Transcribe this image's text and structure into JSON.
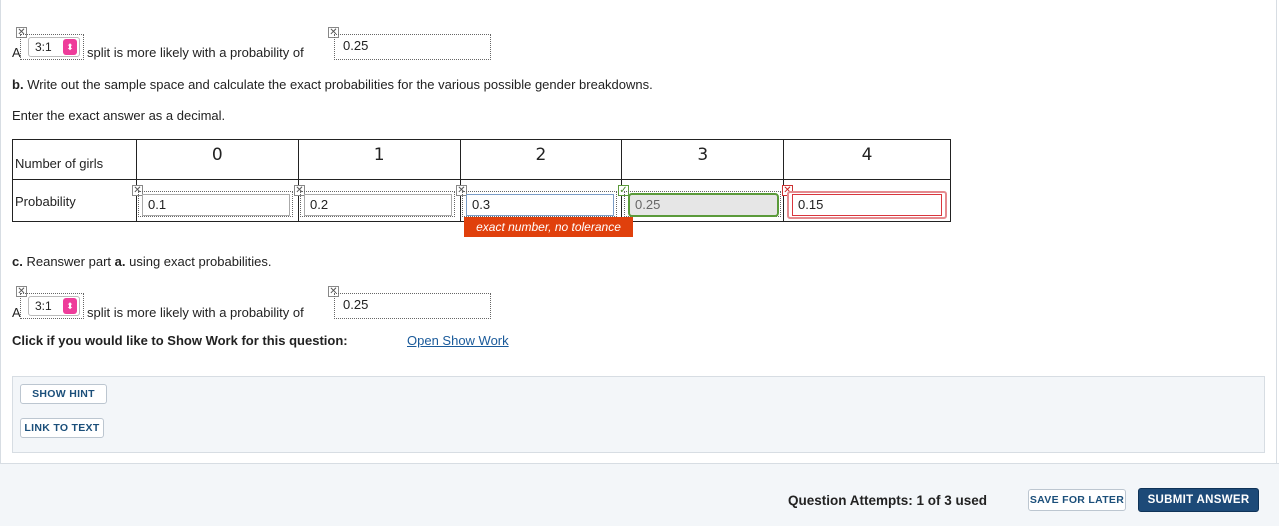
{
  "part_a": {
    "prefix": "A",
    "ratio_select": "3:1",
    "middle_text": "split is more likely with a probability of",
    "probability_value": "0.25"
  },
  "part_b": {
    "label": "b.",
    "instruction": "Write out the sample space and calculate the exact probabilities for the various possible gender breakdowns.",
    "decimal_note": "Enter the exact answer as a decimal."
  },
  "table": {
    "row1_header": "Number of girls",
    "row2_header": "Probability",
    "columns": [
      "0",
      "1",
      "2",
      "3",
      "4"
    ],
    "values": [
      "0.1",
      "0.2",
      "0.3",
      "0.25",
      "0.15"
    ]
  },
  "tooltip": "exact number, no tolerance",
  "part_c": {
    "label": "c.",
    "text_before": "Reanswer part",
    "bold_ref": "a.",
    "text_after": "using exact probabilities.",
    "prefix": "A",
    "ratio_select": "3:1",
    "middle_text": "split is more likely with a probability of",
    "probability_value": "0.25"
  },
  "show_work": {
    "prompt": "Click if you would like to Show Work for this question:",
    "link": "Open Show Work"
  },
  "buttons": {
    "show_hint": "SHOW HINT",
    "link_to_text": "LINK TO TEXT",
    "save_for_later": "SAVE FOR LATER",
    "submit_answer": "SUBMIT ANSWER"
  },
  "attempts": "Question Attempts: 1 of 3 used",
  "colors": {
    "select_arrow": "#ee3c9a",
    "correct": "#5a9a3a",
    "incorrect": "#d9363e",
    "tooltip_bg": "#e0400c",
    "submit_bg": "#1d4a78"
  }
}
